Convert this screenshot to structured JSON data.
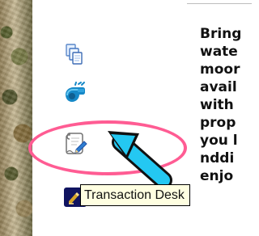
{
  "tooltip": {
    "text": "Transaction Desk"
  },
  "article": {
    "lines": [
      "Bring",
      "wate",
      "moor",
      "avail",
      "with",
      "prop",
      "you l",
      "nddi",
      "enjo"
    ]
  },
  "icons": {
    "pages": "pages-icon",
    "whistle": "whistle-icon",
    "scroll": "scroll-pencil-icon",
    "transaction_desk": "transaction-desk-icon"
  },
  "colors": {
    "highlight_ellipse": "#ff5c93",
    "pointer_arrow": "#24c8f2",
    "tooltip_background": "#ffffe1"
  }
}
